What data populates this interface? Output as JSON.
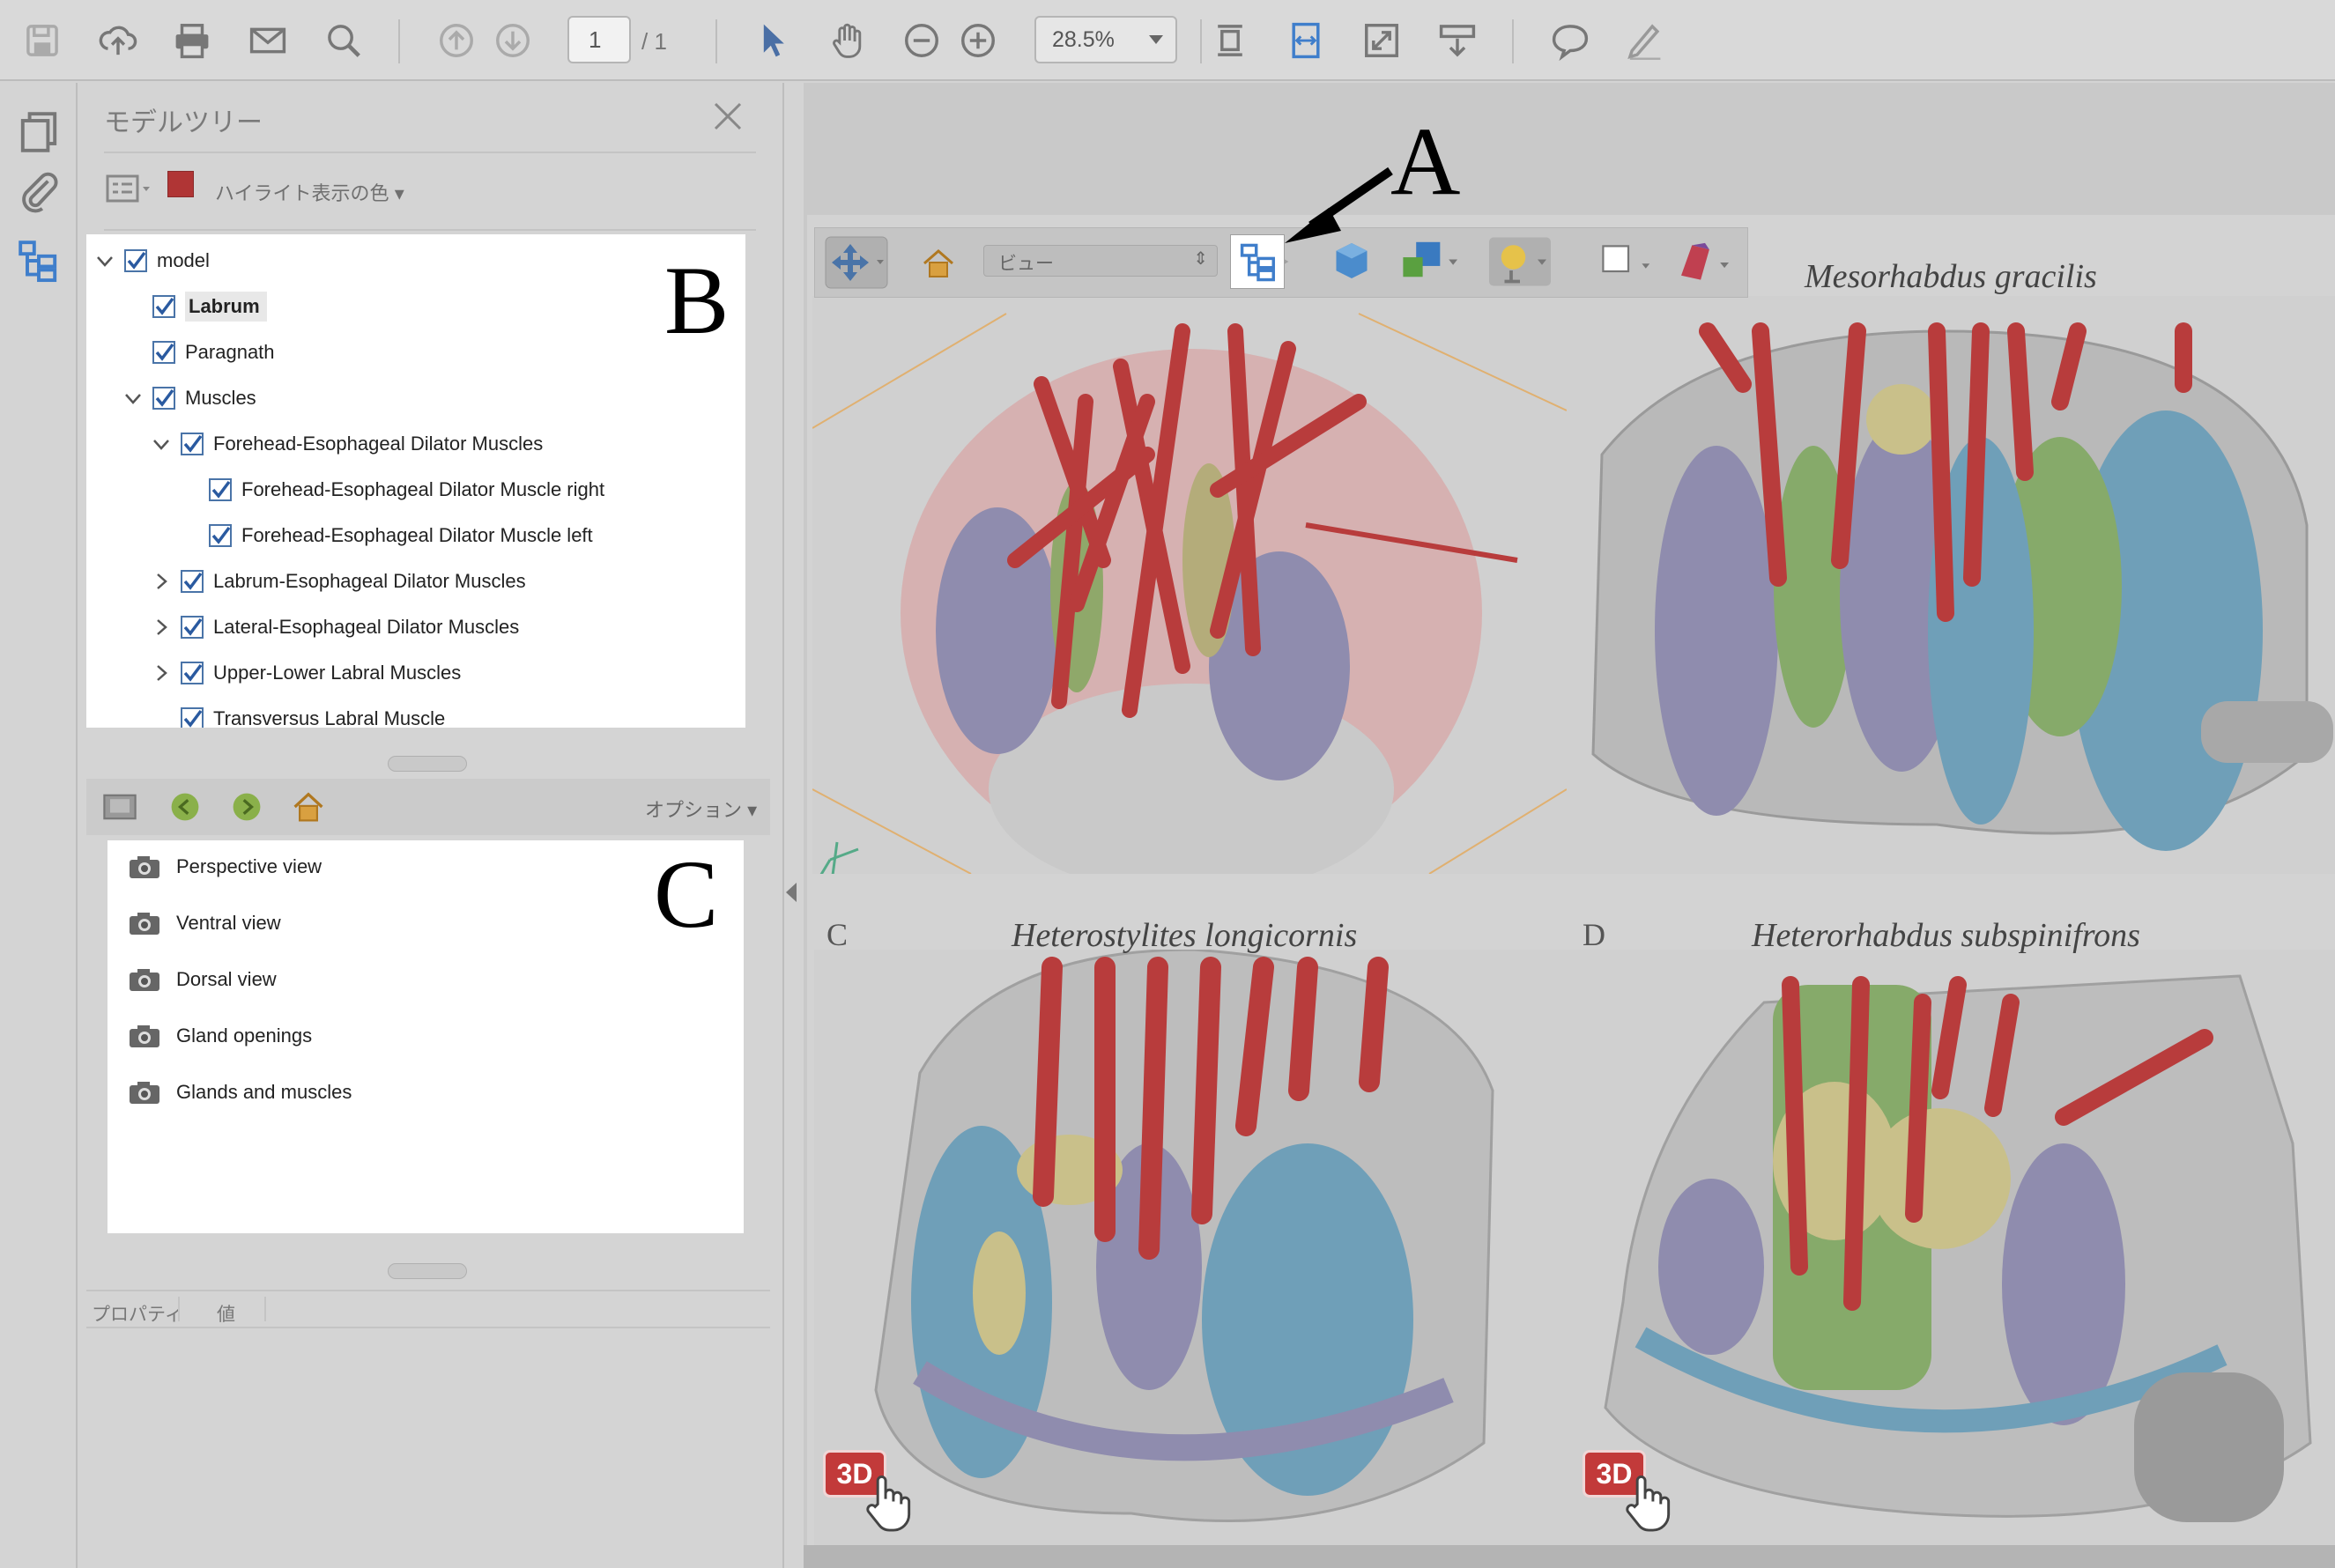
{
  "toolbar": {
    "page_current": "1",
    "page_total": "/ 1",
    "zoom": "28.5%",
    "icons": [
      "save-icon",
      "upload-icon",
      "print-icon",
      "mail-icon",
      "search-icon",
      "prev-page-icon",
      "next-page-icon",
      "select-arrow-icon",
      "hand-icon",
      "zoom-out-icon",
      "zoom-in-icon",
      "fit-page-icon",
      "fit-width-icon",
      "fullscreen-icon",
      "scroll-icon",
      "comment-icon",
      "sign-icon"
    ]
  },
  "model_tree_panel": {
    "title": "モデルツリー",
    "highlight_color_label": "ハイライト表示の色",
    "highlight_color": "#b03535",
    "items": [
      {
        "label": "model",
        "indent": 0,
        "twisty": "open"
      },
      {
        "label": "Labrum",
        "indent": 1,
        "twisty": "none",
        "selected": true
      },
      {
        "label": "Paragnath",
        "indent": 1,
        "twisty": "none"
      },
      {
        "label": "Muscles",
        "indent": 1,
        "twisty": "open"
      },
      {
        "label": "Forehead-Esophageal Dilator Muscles",
        "indent": 2,
        "twisty": "open"
      },
      {
        "label": "Forehead-Esophageal Dilator Muscle right",
        "indent": 3,
        "twisty": "none"
      },
      {
        "label": "Forehead-Esophageal Dilator Muscle left",
        "indent": 3,
        "twisty": "none"
      },
      {
        "label": "Labrum-Esophageal  Dilator Muscles",
        "indent": 2,
        "twisty": "closed"
      },
      {
        "label": "Lateral-Esophageal Dilator Muscles",
        "indent": 2,
        "twisty": "closed"
      },
      {
        "label": "Upper-Lower Labral Muscles",
        "indent": 2,
        "twisty": "closed"
      },
      {
        "label": "Transversus Labral Muscle",
        "indent": 2,
        "twisty": "none"
      }
    ]
  },
  "views_panel": {
    "options_label": "オプション",
    "views": [
      "Perspective view",
      "Ventral view",
      "Dorsal view",
      "Gland openings",
      "Glands and muscles"
    ]
  },
  "properties_panel": {
    "col_property": "プロパティ",
    "col_value": "値"
  },
  "viewer_toolbar": {
    "view_select": "ビュー"
  },
  "figure": {
    "annotation_a": "A",
    "annotation_b": "B",
    "annotation_c": "C",
    "panels": [
      {
        "species": "Mesorhabdus gracilis",
        "letter": ""
      },
      {
        "species": "Heterostylites longicornis",
        "letter": "C"
      },
      {
        "species": "Heterorhabdus subspinifrons",
        "letter": "D"
      }
    ],
    "badge_3d": "3D"
  }
}
